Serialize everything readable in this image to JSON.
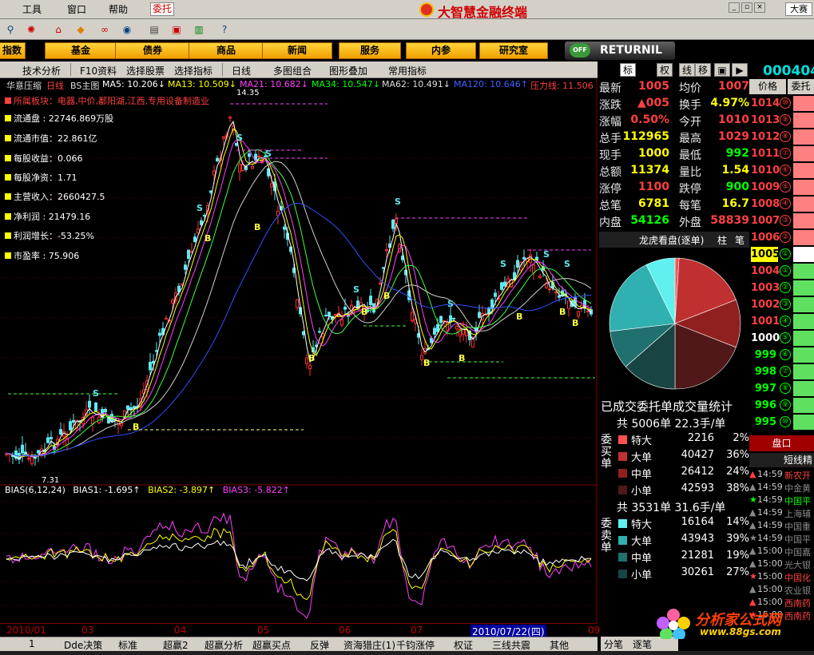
{
  "menu": {
    "tools": "工具",
    "window": "窗口",
    "help": "帮助",
    "commission": "委托",
    "brand": "大智慧金融终端",
    "grand": "大赛"
  },
  "categories": [
    "指数",
    "基金",
    "债券",
    "商品",
    "新闻",
    "服务",
    "内参",
    "研究室"
  ],
  "returnil": {
    "label": "RETURNIL",
    "off": "OFF"
  },
  "toolbar2": [
    "技术分析",
    "F10资料",
    "选择股票",
    "选择指标",
    "日线",
    "多图组合",
    "图形叠加",
    "常用指标"
  ],
  "header": {
    "name": "华意压缩",
    "period": "日线",
    "main": "BS主图",
    "ma5": "MA5: 10.206↓",
    "ma13": "MA13: 10.509↓",
    "ma21": "MA21: 10.682↓",
    "ma34": "MA34: 10.547↓",
    "ma62": "MA62: 10.491↓",
    "ma120": "MA120: 10.646↑",
    "pressure": "压力线: 11.506"
  },
  "fund": {
    "sector": "所属板块：电器,中价,鄱阳湖,江西,专用设备制造业",
    "float": "流通盘 : 22746.869万股",
    "fmv": "流通市值：22.861亿",
    "eps": "每股收益：0.066",
    "nav": "每股净资：1.71",
    "rev": "主营收入：2660427.5",
    "profit": "净利润 : 21479.16",
    "growth": "利润增长：-53.25%",
    "pe": "市盈率 : 75.906"
  },
  "chart_labels": {
    "high": "14.35",
    "low": "7.31",
    "s": "S",
    "b": "B"
  },
  "bias": {
    "name": "BIAS(6,12,24)",
    "b1": "BIAS1: -1.695↑",
    "b2": "BIAS2: -3.897↑",
    "b3": "BIAS3: -5.822↑"
  },
  "dates": {
    "d1": "2010/01",
    "d2": "03",
    "d3": "04",
    "d4": "05",
    "d5": "06",
    "d6": "07",
    "hl": "2010/07/22(四)",
    "d7": "09"
  },
  "bottomtabs": [
    "1",
    "Dde决策",
    "标准",
    "超赢2",
    "超赢分析",
    "超赢买点",
    "反弹",
    "资海猎庄(1)",
    "千钧涨停",
    "权证",
    "三线共震",
    "其他"
  ],
  "rtabs": [
    "分笔",
    "逐笔"
  ],
  "rhead": [
    "标",
    "权",
    "线",
    "移"
  ],
  "quote": {
    "rows": [
      {
        "l": "最新",
        "v": "1005",
        "c": "#ff4040",
        "l2": "均价",
        "v2": "1007",
        "c2": "#ff4040"
      },
      {
        "l": "涨跌",
        "v": "▲005",
        "c": "#ff4040",
        "l2": "换手",
        "v2": "4.97%",
        "c2": "#ffff00"
      },
      {
        "l": "涨幅",
        "v": "0.50%",
        "c": "#ff4040",
        "l2": "今开",
        "v2": "1010",
        "c2": "#ff4040"
      },
      {
        "l": "总手",
        "v": "112965",
        "c": "#ffff00",
        "l2": "最高",
        "v2": "1029",
        "c2": "#ff4040"
      },
      {
        "l": "现手",
        "v": "1000",
        "c": "#ffff00",
        "l2": "最低",
        "v2": "992",
        "c2": "#00ff00"
      },
      {
        "l": "总额",
        "v": "11374",
        "c": "#ffff00",
        "l2": "量比",
        "v2": "1.54",
        "c2": "#ffff00"
      },
      {
        "l": "涨停",
        "v": "1100",
        "c": "#ff4040",
        "l2": "跌停",
        "v2": "900",
        "c2": "#00ff00"
      },
      {
        "l": "总笔",
        "v": "6781",
        "c": "#ffff00",
        "l2": "每笔",
        "v2": "16.7",
        "c2": "#ffff00"
      },
      {
        "l": "内盘",
        "v": "54126",
        "c": "#00ff00",
        "l2": "外盘",
        "v2": "58839",
        "c2": "#ff4040"
      }
    ]
  },
  "lhb": {
    "title": "龙虎看盘(逐单)",
    "t1": "柱",
    "t2": "笔"
  },
  "pie_title": "已成交委托单成交量统计",
  "buy": {
    "summary": "共 5006单 22.3手/单",
    "side": "委买单",
    "rows": [
      {
        "l": "特大",
        "n": "2216",
        "p": "2%",
        "c": "#ff5050"
      },
      {
        "l": "大单",
        "n": "40427",
        "p": "36%",
        "c": "#c03030"
      },
      {
        "l": "中单",
        "n": "26412",
        "p": "24%",
        "c": "#902020"
      },
      {
        "l": "小单",
        "n": "42593",
        "p": "38%",
        "c": "#501818"
      }
    ]
  },
  "sell": {
    "summary": "共 3531单 31.6手/单",
    "side": "委卖单",
    "rows": [
      {
        "l": "特大",
        "n": "16164",
        "p": "14%",
        "c": "#60f0f0"
      },
      {
        "l": "大单",
        "n": "43943",
        "p": "39%",
        "c": "#30b0b0"
      },
      {
        "l": "中单",
        "n": "21281",
        "p": "19%",
        "c": "#207070"
      },
      {
        "l": "小单",
        "n": "30261",
        "p": "27%",
        "c": "#184444"
      }
    ]
  },
  "pie": {
    "slices": [
      2216,
      40427,
      26412,
      42593,
      30261,
      21281,
      43943,
      16164
    ],
    "colors": [
      "#ff5050",
      "#c03030",
      "#902020",
      "#501818",
      "#184444",
      "#207070",
      "#30b0b0",
      "#60f0f0"
    ]
  },
  "farright": {
    "code": "000404",
    "h1": "价格",
    "h2": "委托",
    "pankou": "盘口",
    "dxj": "短线精",
    "prices": [
      {
        "p": "1014",
        "n": "⑩",
        "c": "#ff4040"
      },
      {
        "p": "1013",
        "n": "⑨",
        "c": "#ff4040"
      },
      {
        "p": "1012",
        "n": "⑧",
        "c": "#ff4040"
      },
      {
        "p": "1011",
        "n": "⑦",
        "c": "#ff4040"
      },
      {
        "p": "1010",
        "n": "⑥",
        "c": "#ff4040"
      },
      {
        "p": "1009",
        "n": "⑤",
        "c": "#ff4040"
      },
      {
        "p": "1008",
        "n": "④",
        "c": "#ff4040"
      },
      {
        "p": "1007",
        "n": "③",
        "c": "#ff4040"
      },
      {
        "p": "1006",
        "n": "②",
        "c": "#ff4040"
      },
      {
        "p": "1005",
        "n": "①",
        "c": "#000"
      },
      {
        "p": "1004",
        "n": "①",
        "c": "#ff4040"
      },
      {
        "p": "1003",
        "n": "②",
        "c": "#ff4040"
      },
      {
        "p": "1002",
        "n": "③",
        "c": "#ff4040"
      },
      {
        "p": "1001",
        "n": "④",
        "c": "#ff4040"
      },
      {
        "p": "1000",
        "n": "⑤",
        "c": "#fff"
      },
      {
        "p": "999",
        "n": "⑥",
        "c": "#00ff00"
      },
      {
        "p": "998",
        "n": "⑦",
        "c": "#00ff00"
      },
      {
        "p": "997",
        "n": "⑧",
        "c": "#00ff00"
      },
      {
        "p": "996",
        "n": "⑨",
        "c": "#00ff00"
      },
      {
        "p": "995",
        "n": "⑩",
        "c": "#00ff00"
      }
    ],
    "news": [
      {
        "t": "14:59",
        "n": "新农开",
        "c": "#ff4040"
      },
      {
        "t": "14:59",
        "n": "中金黄",
        "c": "#888"
      },
      {
        "t": "14:59",
        "n": "中国平",
        "c": "#00ff00"
      },
      {
        "t": "14:59",
        "n": "上海辅",
        "c": "#888"
      },
      {
        "t": "14:59",
        "n": "中国重",
        "c": "#888"
      },
      {
        "t": "14:59",
        "n": "中国平",
        "c": "#888"
      },
      {
        "t": "15:00",
        "n": "中国嘉",
        "c": "#888"
      },
      {
        "t": "15:00",
        "n": "光大银",
        "c": "#888"
      },
      {
        "t": "15:00",
        "n": "中国化",
        "c": "#ff4040"
      },
      {
        "t": "15:00",
        "n": "农业银",
        "c": "#888"
      },
      {
        "t": "15:00",
        "n": "西南药",
        "c": "#ff4040"
      },
      {
        "t": "15:00",
        "n": "西南药",
        "c": "#ff4040"
      }
    ]
  },
  "watermark": {
    "title": "分析家公式网",
    "url": "www.88gs.com"
  }
}
